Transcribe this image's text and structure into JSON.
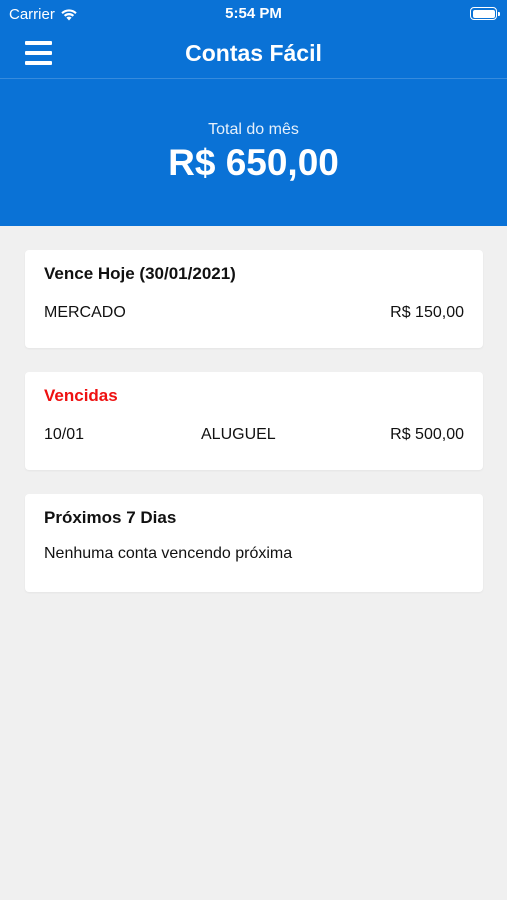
{
  "status_bar": {
    "carrier": "Carrier",
    "time": "5:54 PM",
    "icons": [
      "wifi-icon",
      "battery-icon"
    ]
  },
  "nav": {
    "title": "Contas Fácil",
    "menu_icon": "hamburger-menu-icon"
  },
  "summary": {
    "label": "Total do mês",
    "amount": "R$ 650,00"
  },
  "today": {
    "title": "Vence Hoje (30/01/2021)",
    "items": [
      {
        "name": "MERCADO",
        "value": "R$ 150,00"
      }
    ]
  },
  "overdue": {
    "title": "Vencidas",
    "items": [
      {
        "date": "10/01",
        "name": "ALUGUEL",
        "value": "R$ 500,00"
      }
    ]
  },
  "next7": {
    "title": "Próximos 7 Dias",
    "empty_message": "Nenhuma conta vencendo próxima"
  },
  "colors": {
    "primary": "#0a72d6",
    "background": "#f0f0f0",
    "overdue_title": "#ee1111"
  }
}
